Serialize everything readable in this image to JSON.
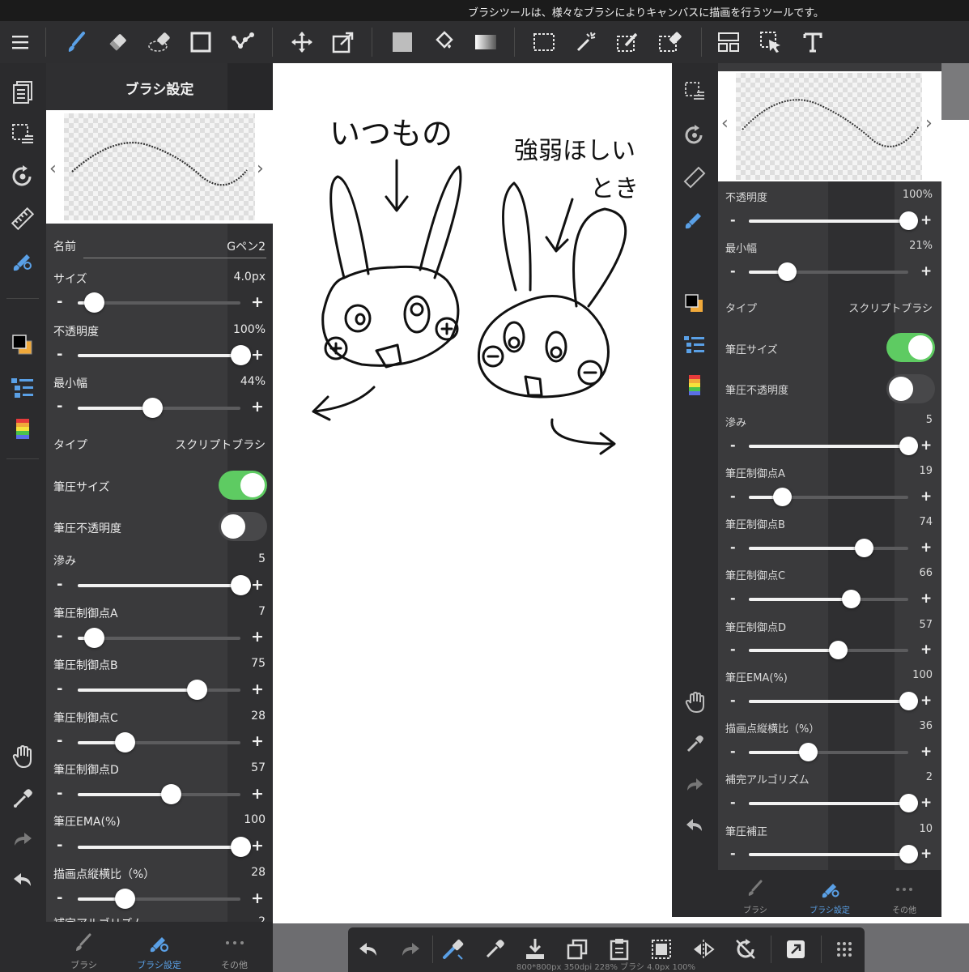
{
  "tip": {
    "text": "ブラシツールは、様々なブラシによりキャンバスに描画を行うツールです。"
  },
  "toolbar": {
    "icons": [
      "menu-icon",
      "brush-icon",
      "eraser-icon",
      "lasso-eraser-icon",
      "rectangle-icon",
      "polyline-icon",
      "move-icon",
      "transform-icon",
      "fill-color-icon",
      "bucket-icon",
      "gradient-icon",
      "selection-rect-icon",
      "magic-wand-icon",
      "selection-pen-icon",
      "selection-eraser-icon",
      "panel-layout-icon",
      "select-layer-icon",
      "text-icon"
    ]
  },
  "panel": {
    "title": "ブラシ設定",
    "name_label": "名前",
    "name_value": "Gペン2",
    "size": {
      "label": "サイズ",
      "value": "4.0px",
      "fraction": 0.1
    },
    "opacity": {
      "label": "不透明度",
      "value": "100%",
      "fraction": 1.0
    },
    "min_width": {
      "label": "最小幅",
      "value": "44%",
      "fraction": 0.46
    },
    "type": {
      "label": "タイプ",
      "value": "スクリプトブラシ"
    },
    "pressure_size": {
      "label": "筆圧サイズ",
      "on": true
    },
    "pressure_opacity": {
      "label": "筆圧不透明度",
      "on": false
    },
    "blur": {
      "label": "滲み",
      "value": "5",
      "fraction": 1.0
    },
    "point_a": {
      "label": "筆圧制御点A",
      "value": "7",
      "fraction": 0.1
    },
    "point_b": {
      "label": "筆圧制御点B",
      "value": "75",
      "fraction": 0.73
    },
    "point_c": {
      "label": "筆圧制御点C",
      "value": "28",
      "fraction": 0.29
    },
    "point_d": {
      "label": "筆圧制御点D",
      "value": "57",
      "fraction": 0.57
    },
    "ema": {
      "label": "筆圧EMA(%)",
      "value": "100",
      "fraction": 1.0
    },
    "aspect": {
      "label": "描画点縦横比（%）",
      "value": "28",
      "fraction": 0.29
    },
    "cut_label": "補完アルゴリズム",
    "cut_value": "2",
    "tabs": [
      "ブラシ",
      "ブラシ設定",
      "その他"
    ],
    "minus": "-",
    "plus": "+"
  },
  "drawing_text": {
    "left_caption": "いつもの",
    "right_caption_1": "強弱ほしい",
    "right_caption_2": "とき"
  },
  "shot": {
    "opacity": {
      "label": "不透明度",
      "value": "100%",
      "fraction": 1.0
    },
    "min_width": {
      "label": "最小幅",
      "value": "21%",
      "fraction": 0.24
    },
    "type": {
      "label": "タイプ",
      "value": "スクリプトブラシ"
    },
    "pressure_size": {
      "label": "筆圧サイズ",
      "on": true
    },
    "pressure_opacity": {
      "label": "筆圧不透明度",
      "on": false
    },
    "blur": {
      "label": "滲み",
      "value": "5",
      "fraction": 1.0
    },
    "point_a": {
      "label": "筆圧制御点A",
      "value": "19",
      "fraction": 0.21
    },
    "point_b": {
      "label": "筆圧制御点B",
      "value": "74",
      "fraction": 0.72
    },
    "point_c": {
      "label": "筆圧制御点C",
      "value": "66",
      "fraction": 0.64
    },
    "point_d": {
      "label": "筆圧制御点D",
      "value": "57",
      "fraction": 0.56
    },
    "ema": {
      "label": "筆圧EMA(%)",
      "value": "100",
      "fraction": 1.0
    },
    "aspect": {
      "label": "描画点縦横比（%）",
      "value": "36",
      "fraction": 0.37
    },
    "algo": {
      "label": "補完アルゴリズム",
      "value": "2",
      "fraction": 1.0
    },
    "correction": {
      "label": "筆圧補正",
      "value": "10",
      "fraction": 1.0
    },
    "tabs": [
      "ブラシ",
      "ブラシ設定",
      "その他"
    ],
    "minus": "-",
    "plus": "+"
  },
  "bottom": {
    "status": "800*800px 350dpi 228% ブラシ 4.0px 100%"
  },
  "colors": {
    "accent": "#5aa0e6",
    "toggle_on": "#5ecb62",
    "panel": "#3a3a3c",
    "bar": "#2b2b2d"
  }
}
